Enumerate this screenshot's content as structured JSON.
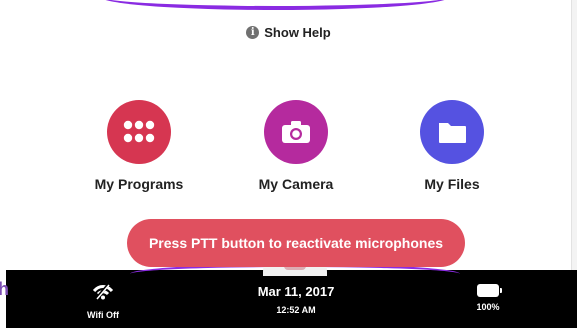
{
  "help": {
    "label": "Show Help",
    "icon": "info-icon"
  },
  "apps": [
    {
      "label": "My Programs",
      "icon": "grid-icon",
      "color": "#d63651"
    },
    {
      "label": "My Camera",
      "icon": "camera-icon",
      "color": "#b52a9e"
    },
    {
      "label": "My Files",
      "icon": "folder-icon",
      "color": "#5552e1"
    }
  ],
  "toast": {
    "message": "Press PTT button to reactivate microphones",
    "color": "#e0505f"
  },
  "status_bar": {
    "wifi": {
      "label": "Wifi Off",
      "icon": "wifi-off-icon"
    },
    "date": "Mar 11, 2017",
    "time": "12:52 AM",
    "battery": {
      "label": "100%",
      "icon": "battery-icon",
      "level": 1.0
    }
  },
  "edge_text": "h",
  "accent_color": "#8a2be2"
}
